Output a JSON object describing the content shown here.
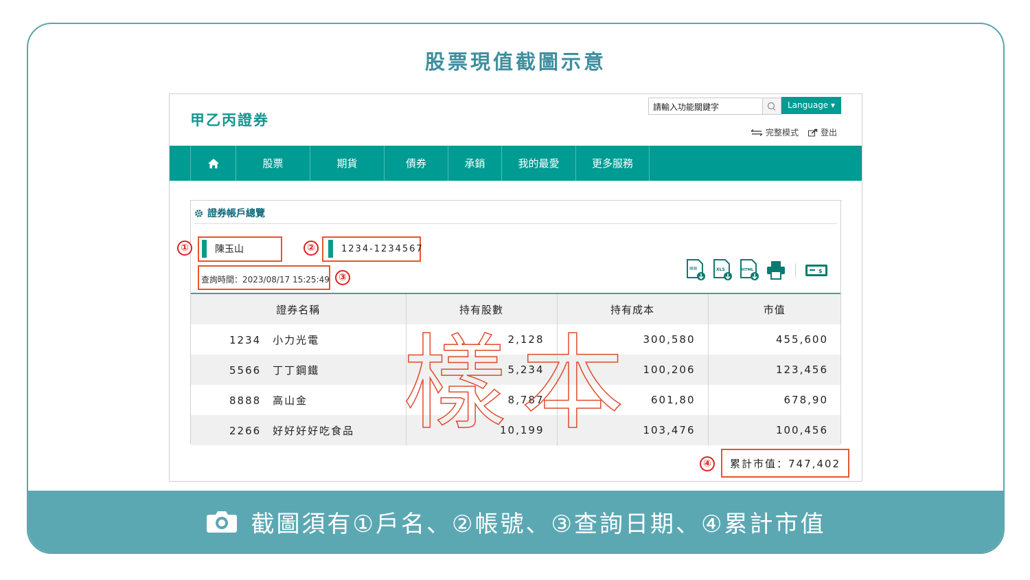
{
  "card": {
    "title": "股票現值截圖示意",
    "footer": "截圖須有①戶名、②帳號、③查詢日期、④累計市值"
  },
  "app": {
    "brand": "甲乙丙證券",
    "search_placeholder": "請輸入功能關鍵字",
    "language_label": "Language ▾",
    "full_mode": "完整模式",
    "logout": "登出"
  },
  "nav": {
    "items": [
      "股票",
      "期貨",
      "債券",
      "承銷",
      "我的最愛",
      "更多服務"
    ]
  },
  "panel": {
    "title": "證券帳戶總覽",
    "account_name": "陳玉山",
    "account_number": "1234-1234567",
    "query_time": "查詢時間：2023/08/17 15:25:49",
    "total": "累計市值：747,402"
  },
  "annotations": {
    "n1": "①",
    "n2": "②",
    "n3": "③",
    "n4": "④"
  },
  "watermark": "樣本",
  "table": {
    "headers": [
      "證券名稱",
      "持有股數",
      "持有成本",
      "市值"
    ],
    "rows": [
      {
        "name": "1234　小力光電",
        "shares": "2,128",
        "cost": "300,580",
        "value": "455,600"
      },
      {
        "name": "5566　丁丁鋼鐵",
        "shares": "5,234",
        "cost": "100,206",
        "value": "123,456"
      },
      {
        "name": "8888　高山金",
        "shares": "8,787",
        "cost": "601,80",
        "value": "678,90"
      },
      {
        "name": "2266　好好好好吃食品",
        "shares": "10,199",
        "cost": "103,476",
        "value": "100,456"
      }
    ]
  },
  "colors": {
    "teal": "#009b93",
    "accent_border": "#e6552e",
    "footer": "#5ba8b3"
  }
}
